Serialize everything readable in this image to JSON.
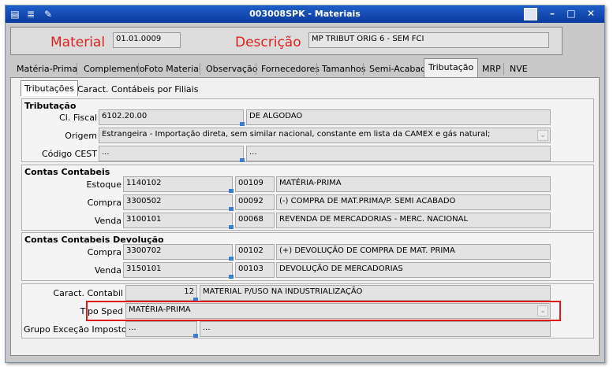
{
  "window": {
    "title": "003008SPK - Materiais"
  },
  "header": {
    "material_label": "Material",
    "material_value": "01.01.0009",
    "descricao_label": "Descrição",
    "descricao_value": "MP TRIBUT ORIG 6 - SEM FCI"
  },
  "tabs": [
    "Matéria-Prima",
    "Complemento",
    "Foto Material",
    "Observação",
    "Fornecedores",
    "Tamanhos",
    "Semi-Acabado",
    "Tributação",
    "MRP",
    "NVE"
  ],
  "active_tab": "Tributação",
  "subtabs": [
    "Tributações",
    "Caract. Contábeis por Filiais"
  ],
  "tributacao": {
    "title": "Tributação",
    "cl_fiscal_label": "Cl. Fiscal",
    "cl_fiscal_code": "6102.20.00",
    "cl_fiscal_desc": "DE ALGODAO",
    "origem_label": "Origem",
    "origem_value": "Estrangeira - Importação direta, sem similar nacional, constante em lista da CAMEX e gás natural;",
    "cest_label": "Código CEST",
    "cest_code": "...",
    "cest_desc": "..."
  },
  "contas": {
    "title": "Contas Contabeis",
    "rows": [
      {
        "label": "Estoque",
        "conta": "1140102",
        "codigo": "00109",
        "descricao": "MATÉRIA-PRIMA"
      },
      {
        "label": "Compra",
        "conta": "3300502",
        "codigo": "00092",
        "descricao": "(-) COMPRA DE MAT.PRIMA/P. SEMI ACABADO"
      },
      {
        "label": "Venda",
        "conta": "3100101",
        "codigo": "00068",
        "descricao": "REVENDA DE MERCADORIAS - MERC. NACIONAL"
      }
    ]
  },
  "devolucao": {
    "title": "Contas Contabeis Devolução",
    "rows": [
      {
        "label": "Compra",
        "conta": "3300702",
        "codigo": "00102",
        "descricao": "(+) DEVOLUÇÃO DE COMPRA DE MAT. PRIMA"
      },
      {
        "label": "Venda",
        "conta": "3150101",
        "codigo": "00103",
        "descricao": "DEVOLUÇÃO DE MERCADORIAS"
      }
    ]
  },
  "extra": {
    "caract_label": "Caract. Contabil",
    "caract_code": "12",
    "caract_desc": "MATERIAL P/USO NA INDUSTRIALIZAÇÃO",
    "tipo_sped_label": "Tipo Sped",
    "tipo_sped_value": "MATÉRIA-PRIMA",
    "grupo_label": "Grupo Exceção Imposto",
    "grupo_code": "...",
    "grupo_desc": "..."
  },
  "colors": {
    "title_bar": "#1f5fc9",
    "highlight": "#e01818",
    "label_red": "#e02020"
  }
}
